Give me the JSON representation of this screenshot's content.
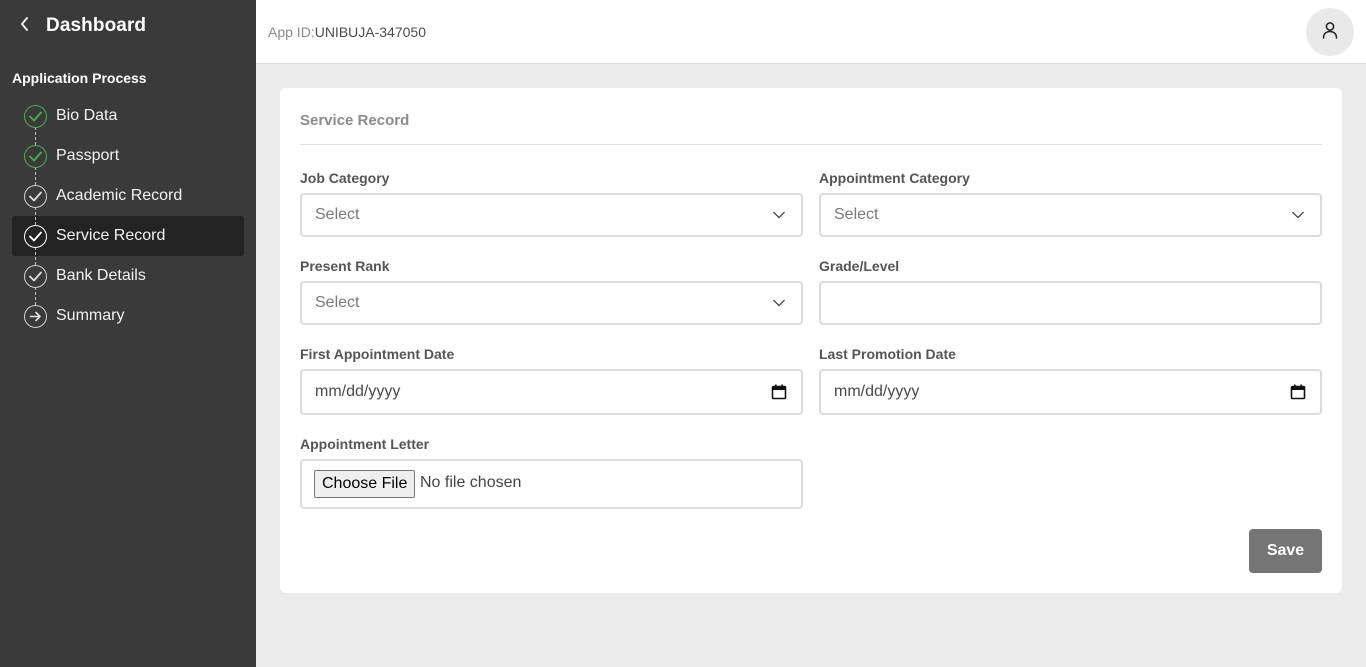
{
  "sidebar": {
    "title": "Dashboard",
    "section_label": "Application Process",
    "steps": [
      {
        "label": "Bio Data",
        "status": "done",
        "icon": "check-icon"
      },
      {
        "label": "Passport",
        "status": "done",
        "icon": "check-icon"
      },
      {
        "label": "Academic Record",
        "status": "complete",
        "icon": "check-icon"
      },
      {
        "label": "Service Record",
        "status": "active",
        "icon": "check-icon"
      },
      {
        "label": "Bank Details",
        "status": "complete",
        "icon": "check-icon"
      },
      {
        "label": "Summary",
        "status": "pending",
        "icon": "arrow-right-icon"
      }
    ]
  },
  "topbar": {
    "app_id_label": "App ID:",
    "app_id_value": "UNIBUJA-347050"
  },
  "form": {
    "title": "Service Record",
    "job_category": {
      "label": "Job Category",
      "placeholder": "Select"
    },
    "appointment_category": {
      "label": "Appointment Category",
      "placeholder": "Select"
    },
    "present_rank": {
      "label": "Present Rank",
      "placeholder": "Select"
    },
    "grade_level": {
      "label": "Grade/Level",
      "value": ""
    },
    "first_appointment_date": {
      "label": "First Appointment Date",
      "placeholder": "mm/dd/yyyy"
    },
    "last_promotion_date": {
      "label": "Last Promotion Date",
      "placeholder": "mm/dd/yyyy"
    },
    "appointment_letter": {
      "label": "Appointment Letter",
      "button": "Choose File",
      "status": "No file chosen"
    },
    "save_label": "Save"
  },
  "colors": {
    "sidebar_bg": "#3a3a3a",
    "active_step_bg": "#232323",
    "done_check": "#4caf50",
    "page_bg": "#ebebeb",
    "save_button_bg": "#757575"
  }
}
